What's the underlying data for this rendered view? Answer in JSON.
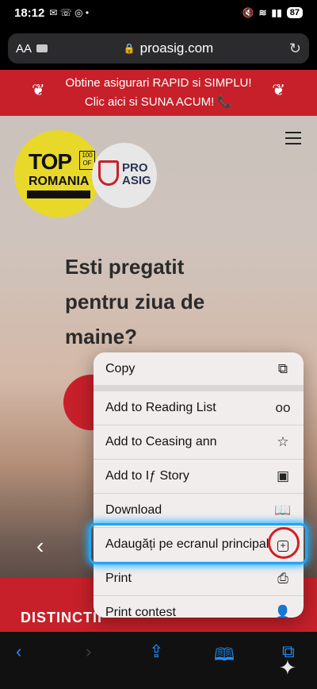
{
  "status_bar": {
    "time": "18:12",
    "battery": "87"
  },
  "browser": {
    "text_size_label": "AA",
    "url": "proasig.com"
  },
  "page": {
    "promo_line1": "Obtine asigurari RAPID si SIMPLU!",
    "promo_line2": "Clic aici si SUNA ACUM! 📞",
    "badge_top_word": "TOP",
    "badge_hundred": "100 OF",
    "badge_romania": "ROMANIA",
    "badge_pro_line1": "PRO",
    "badge_pro_line2": "ASIG",
    "hero_line1": "Esti pregatit",
    "hero_line2": "pentru ziua de",
    "hero_line3": "maine?",
    "section_heading": "DISTINCTII"
  },
  "context_menu": {
    "items": [
      {
        "label": "Copy",
        "icon": "copy-icon"
      },
      {
        "label": "Add to Reading List",
        "icon": "glasses-icon"
      },
      {
        "label": "Add to Ceasing ann",
        "icon": "star-icon"
      },
      {
        "label": "Add to Iƒ Story",
        "icon": "photos-icon"
      },
      {
        "label": "Download",
        "icon": "book-download-icon"
      },
      {
        "label": "Adaugăți pe ecranul principal",
        "icon": "add-square-icon"
      },
      {
        "label": "Print",
        "icon": "printer-icon"
      },
      {
        "label": "Print contest",
        "icon": "person-icon"
      }
    ]
  },
  "colors": {
    "brand_red": "#c7202a",
    "highlight_blue": "#20a4ff",
    "toolbar_blue": "#1e90ff"
  }
}
